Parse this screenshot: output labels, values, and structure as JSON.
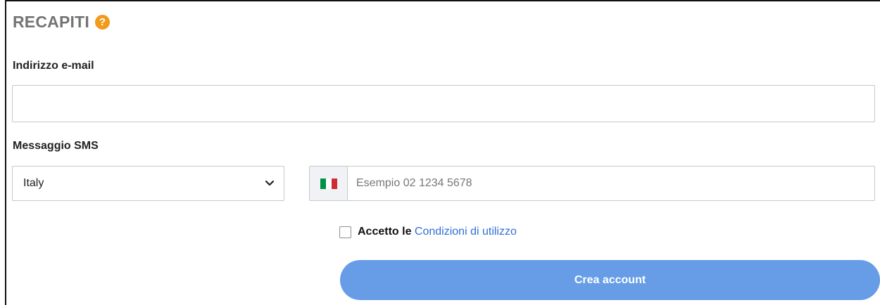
{
  "section": {
    "title": "RECAPITI",
    "help_icon": "question-circle-icon",
    "help_symbol": "?"
  },
  "email": {
    "label": "Indirizzo e-mail",
    "value": "",
    "placeholder": ""
  },
  "sms": {
    "label": "Messaggio SMS",
    "country_value": "Italy",
    "country_icon": "chevron-down-icon",
    "flag_icon": "italy-flag-icon",
    "phone_value": "",
    "phone_placeholder": "Esempio 02 1234 5678"
  },
  "terms": {
    "prefix": "Accetto le",
    "link_text": "Condizioni di utilizzo",
    "checked": false
  },
  "actions": {
    "create_label": "Crea account"
  },
  "colors": {
    "title": "#747474",
    "help_icon": "#f09b1c",
    "link": "#2f6fd6",
    "button": "#669de6",
    "flag_green": "#009246",
    "flag_white": "#ffffff",
    "flag_red": "#ce2b37"
  }
}
